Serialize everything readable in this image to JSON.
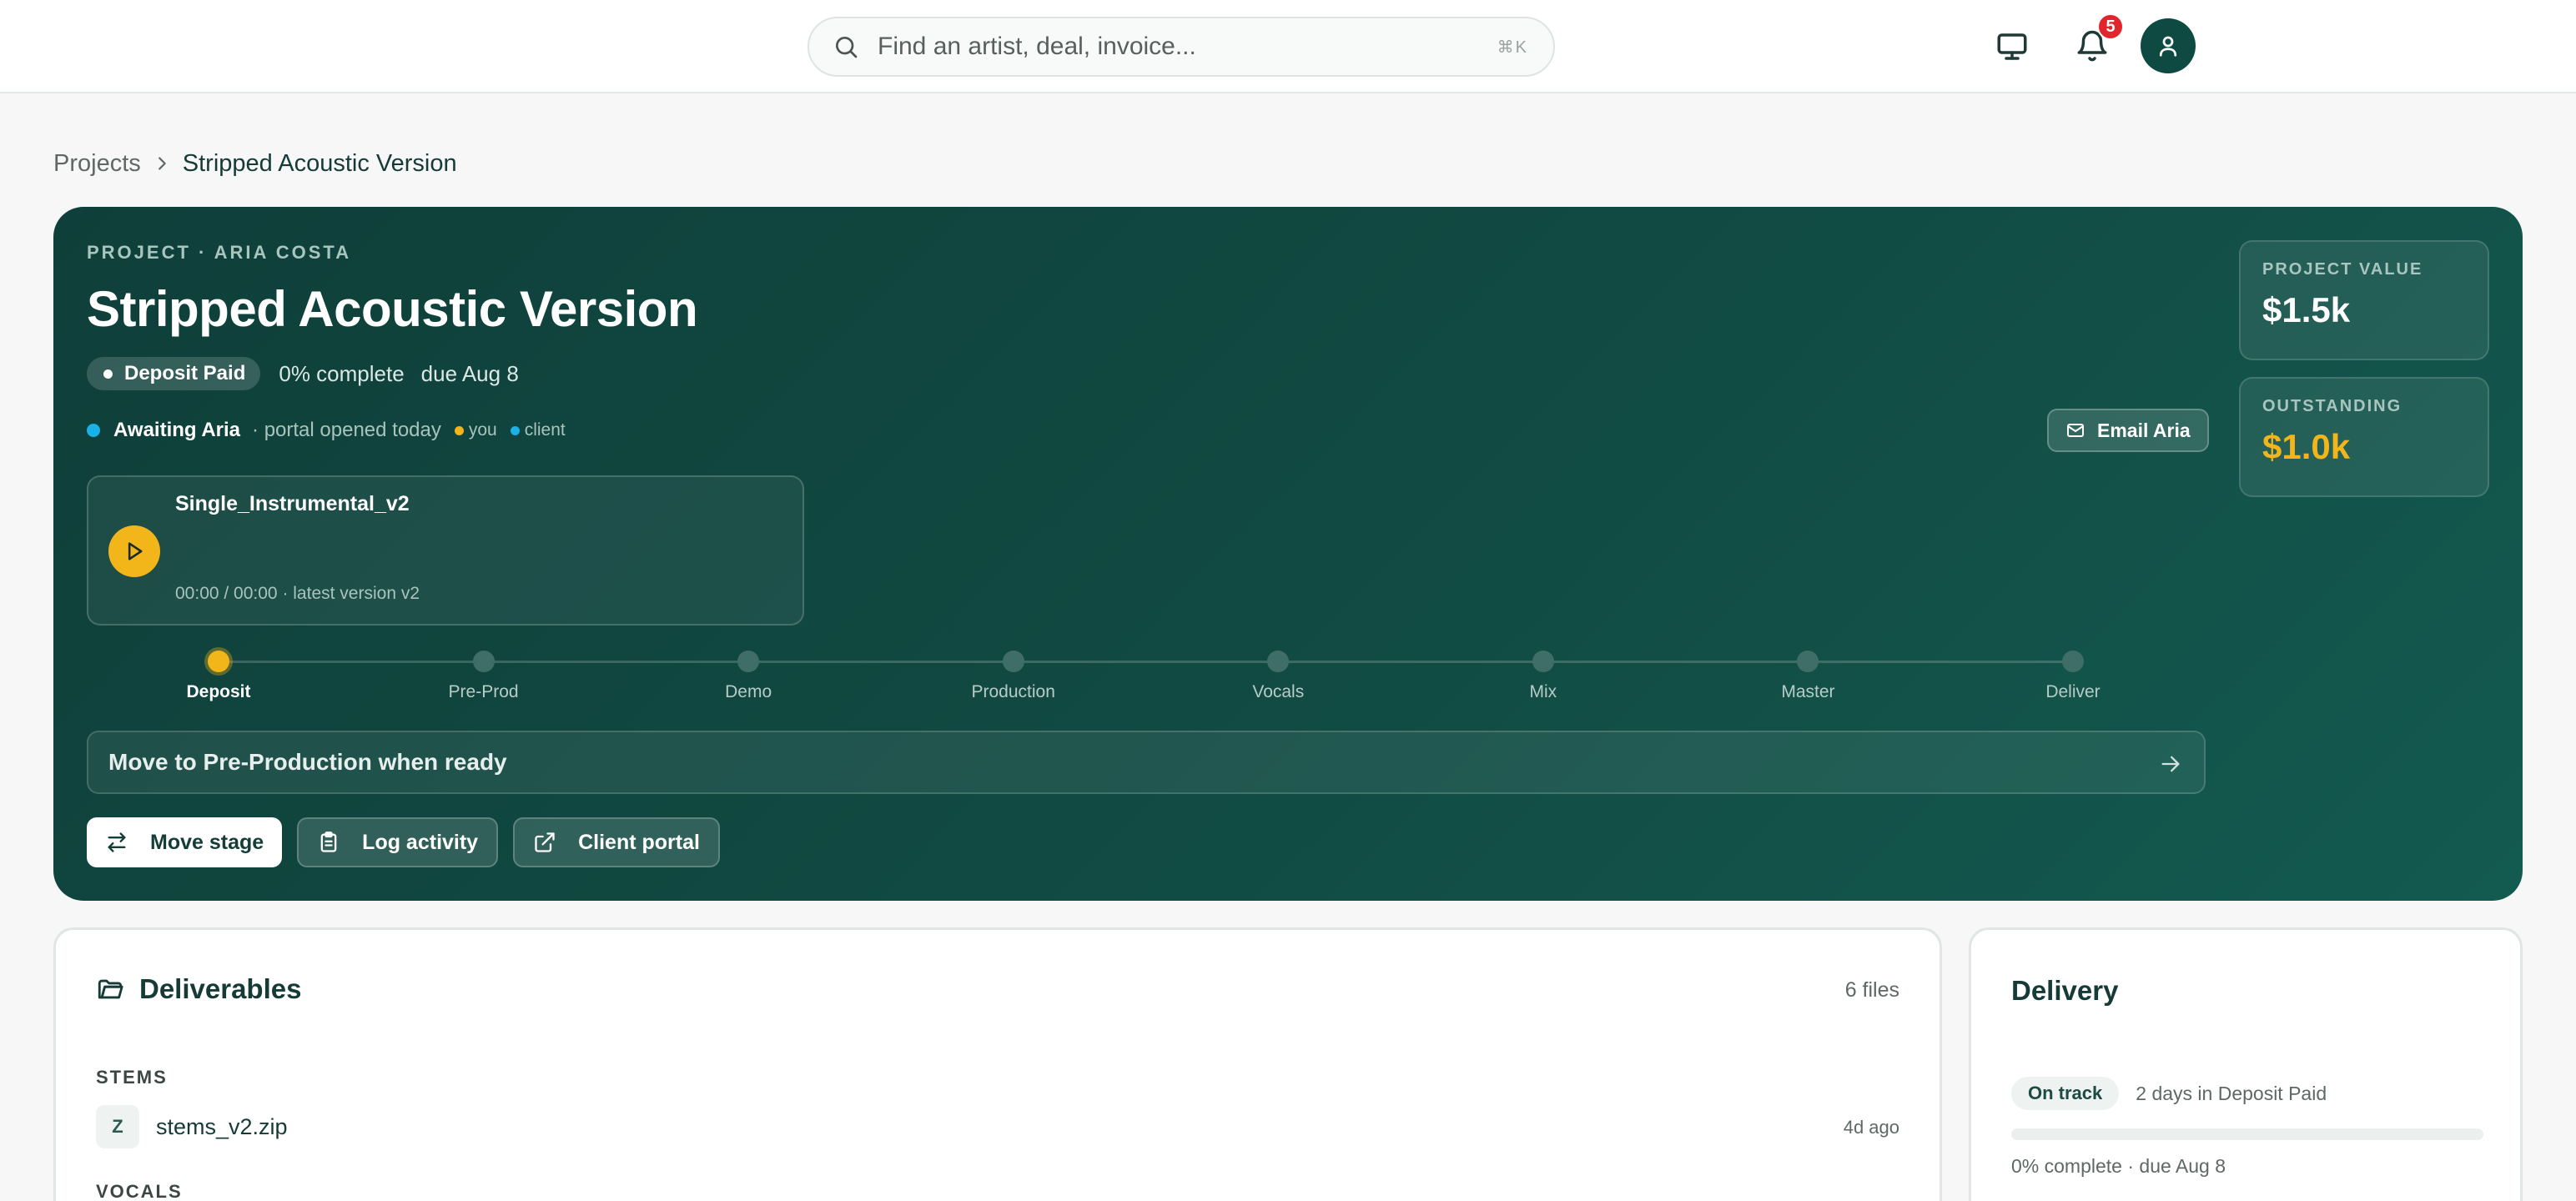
{
  "search": {
    "placeholder": "Find an artist, deal, invoice...",
    "shortcut": "⌘K"
  },
  "header": {
    "notification_count": "5"
  },
  "breadcrumb": {
    "root": "Projects",
    "current": "Stripped Acoustic Version"
  },
  "hero": {
    "eyebrow": "PROJECT · ARIA COSTA",
    "title": "Stripped Acoustic Version",
    "status_pill": "Deposit Paid",
    "progress_text": "0% complete",
    "due_text": "due Aug 8",
    "awaiting_label": "Awaiting Aria",
    "awaiting_note": "· portal opened today",
    "legend_you": "you",
    "legend_client": "client",
    "email_button": "Email Aria",
    "player": {
      "track": "Single_Instrumental_v2",
      "time": "00:00 / 00:00 · latest version v2"
    },
    "stages": [
      {
        "label": "Deposit",
        "active": true
      },
      {
        "label": "Pre-Prod",
        "active": false
      },
      {
        "label": "Demo",
        "active": false
      },
      {
        "label": "Production",
        "active": false
      },
      {
        "label": "Vocals",
        "active": false
      },
      {
        "label": "Mix",
        "active": false
      },
      {
        "label": "Master",
        "active": false
      },
      {
        "label": "Deliver",
        "active": false
      }
    ],
    "next_step": "Move to Pre-Production when ready",
    "actions": {
      "move_stage": "Move stage",
      "log_activity": "Log activity",
      "client_portal": "Client portal"
    },
    "stats": {
      "project_value_label": "PROJECT VALUE",
      "project_value": "$1.5k",
      "outstanding_label": "OUTSTANDING",
      "outstanding": "$1.0k"
    }
  },
  "deliverables": {
    "title": "Deliverables",
    "count": "6 files",
    "sections": [
      {
        "label": "STEMS",
        "file": {
          "icon_letter": "Z",
          "name": "stems_v2.zip",
          "age": "4d ago"
        }
      },
      {
        "label": "VOCALS"
      }
    ]
  },
  "delivery": {
    "title": "Delivery",
    "status": "On track",
    "note": "2 days in Deposit Paid",
    "progress": 0,
    "footer": "0% complete · due Aug 8"
  },
  "colors": {
    "brand_dark": "#0f3f3a",
    "accent_yellow": "#f2b51a",
    "client_blue": "#1ab0e8",
    "badge_red": "#e0252d"
  }
}
